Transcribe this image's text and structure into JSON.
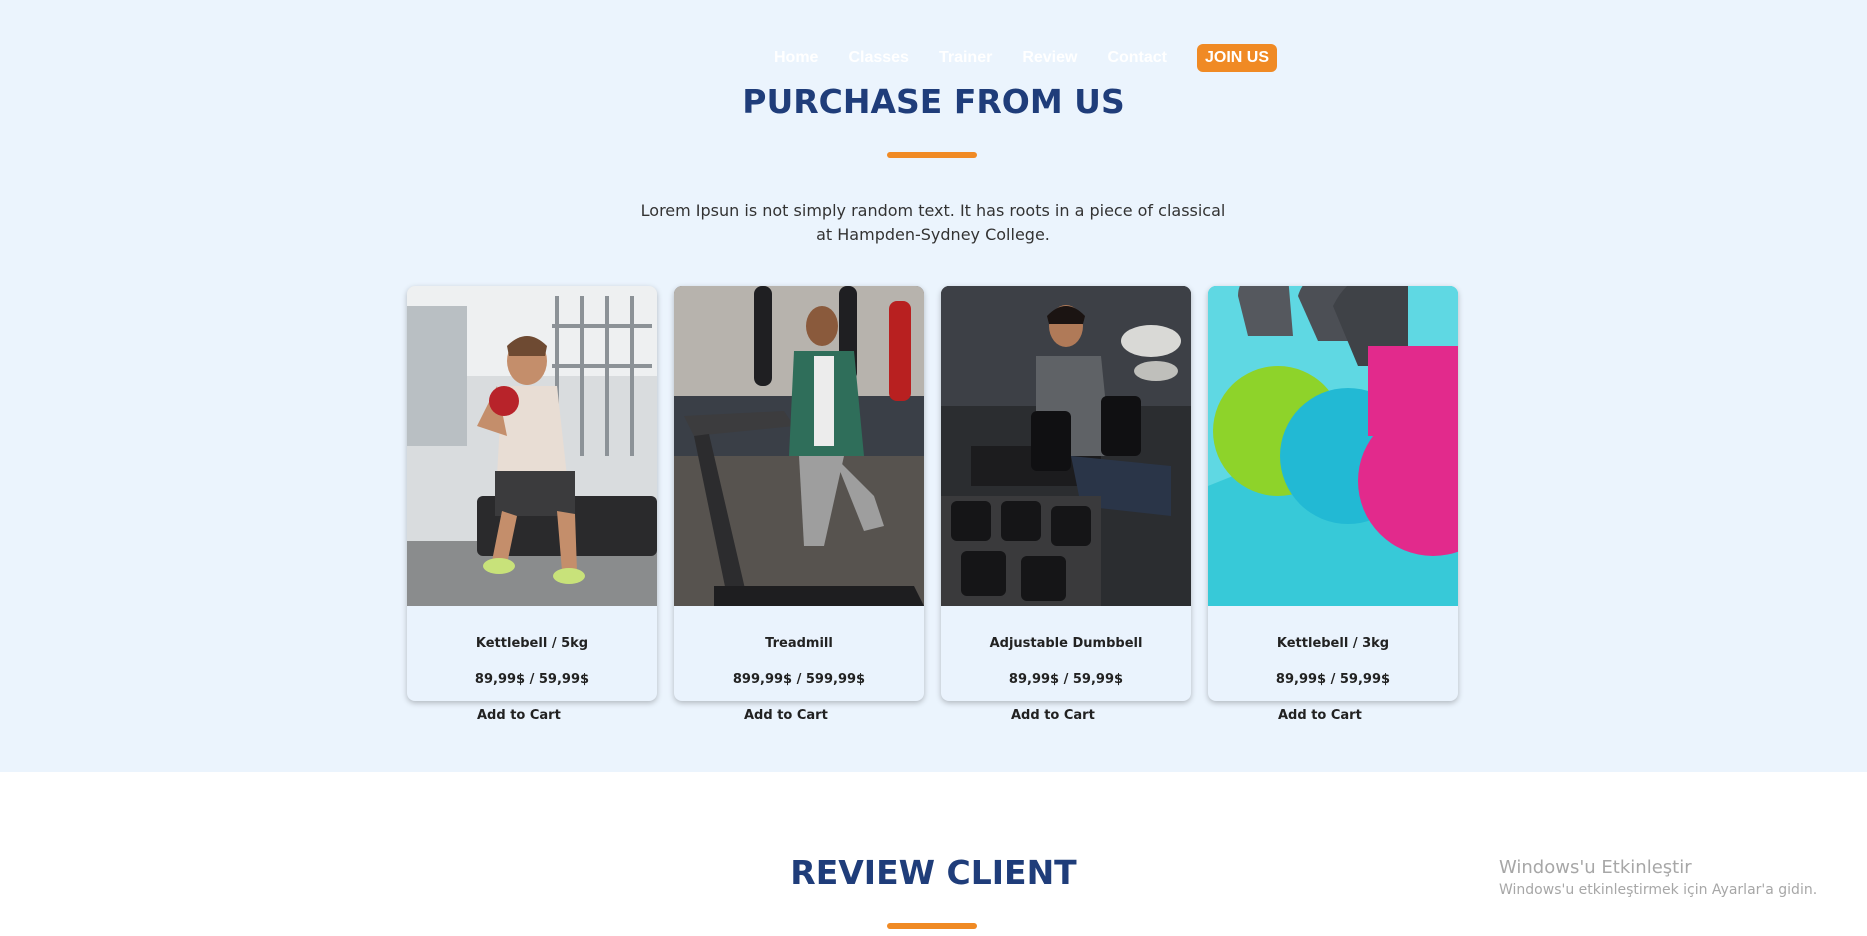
{
  "nav": {
    "items": [
      "Home",
      "Classes",
      "Trainer",
      "Review",
      "Contact"
    ],
    "join_label": "JOIN US"
  },
  "purchase": {
    "title": "PURCHASE FROM US",
    "description": "Lorem Ipsun is not simply random text. It has roots in a piece of classical at Hampden-Sydney College.",
    "products": [
      {
        "name": "Kettlebell / 5kg",
        "price": "89,99$ / 59,99$",
        "cart_label": "Add to Cart"
      },
      {
        "name": "Treadmill",
        "price": "899,99$ / 599,99$",
        "cart_label": "Add to Cart"
      },
      {
        "name": "Adjustable Dumbbell",
        "price": "89,99$ / 59,99$",
        "cart_label": "Add to Cart"
      },
      {
        "name": "Kettlebell / 3kg",
        "price": "89,99$ / 59,99$",
        "cart_label": "Add to Cart"
      }
    ]
  },
  "review": {
    "title": "REVIEW CLIENT"
  },
  "watermark": {
    "title": "Windows'u Etkinleştir",
    "subtitle": "Windows'u etkinleştirmek için Ayarlar'a gidin."
  },
  "colors": {
    "accent": "#f08a24",
    "title": "#1f3d7a",
    "section_bg": "#ebf4fd"
  }
}
